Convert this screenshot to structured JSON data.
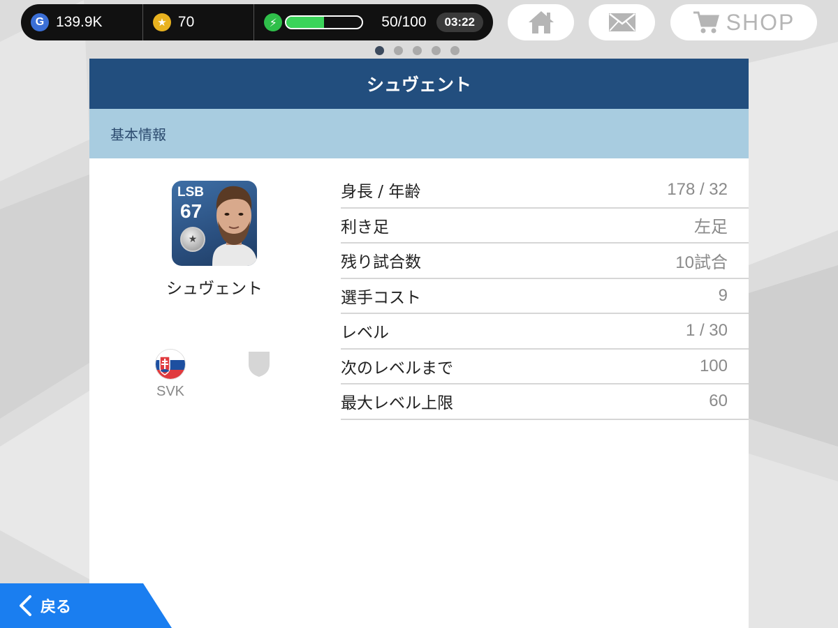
{
  "status_bar": {
    "gp_icon_letter": "G",
    "gp_value": "139.9K",
    "coin_icon": "star-icon",
    "coin_value": "70",
    "energy_icon": "bolt-icon",
    "energy_fraction": 0.5,
    "energy_text": "50/100",
    "timer": "03:22",
    "accent_gp": "#3b6fd6",
    "accent_coin": "#e8b21f",
    "accent_energy": "#3bd45a"
  },
  "top_buttons": {
    "home_icon": "home-icon",
    "mail_icon": "mail-icon",
    "shop_icon": "cart-icon",
    "shop_label": "SHOP"
  },
  "page_indicator": {
    "count": 5,
    "active_index": 0
  },
  "panel": {
    "title": "シュヴェント",
    "section_title": "基本情報",
    "header_color": "#224e7e",
    "section_color": "#a8cce0"
  },
  "player": {
    "position": "LSB",
    "rating": "67",
    "name": "シュヴェント",
    "nationality": "SVK"
  },
  "info_rows": [
    {
      "label": "身長 / 年齢",
      "value": "178 / 32"
    },
    {
      "label": "利き足",
      "value": "左足"
    },
    {
      "label": "残り試合数",
      "value": "10試合"
    },
    {
      "label": "選手コスト",
      "value": "9"
    },
    {
      "label": "レベル",
      "value": "1 / 30"
    },
    {
      "label": "次のレベルまで",
      "value": "100"
    },
    {
      "label": "最大レベル上限",
      "value": "60"
    }
  ],
  "back_button": {
    "label": "戻る",
    "color": "#1a7ef0"
  }
}
